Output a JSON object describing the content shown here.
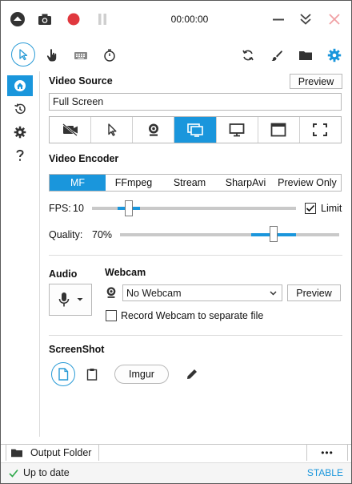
{
  "titlebar": {
    "timer": "00:00:00"
  },
  "video_source": {
    "title": "Video Source",
    "preview_label": "Preview",
    "source_value": "Full Screen",
    "sources": [
      {
        "name": "no-video-icon"
      },
      {
        "name": "region-pointer-icon"
      },
      {
        "name": "webcam-icon"
      },
      {
        "name": "screen-icon",
        "active": true
      },
      {
        "name": "monitor-icon"
      },
      {
        "name": "window-icon"
      },
      {
        "name": "fullscreen-icon"
      }
    ]
  },
  "video_encoder": {
    "title": "Video Encoder",
    "tabs": [
      "MF",
      "FFmpeg",
      "Stream",
      "SharpAvi",
      "Preview Only"
    ],
    "active_tab": "MF",
    "fps_label": "FPS:",
    "fps_value": "10",
    "fps_level": 0.18,
    "limit_label": "Limit",
    "limit_checked": true,
    "quality_label": "Quality:",
    "quality_value": "70%",
    "quality_level": 0.7
  },
  "audio": {
    "title": "Audio"
  },
  "webcam": {
    "title": "Webcam",
    "selected": "No Webcam",
    "preview_label": "Preview",
    "record_separate_label": "Record Webcam to separate file",
    "record_separate_checked": false
  },
  "screenshot": {
    "title": "ScreenShot",
    "imgur_label": "Imgur"
  },
  "output": {
    "folder_label": "Output Folder",
    "more_label": "•••"
  },
  "status": {
    "text": "Up to date",
    "channel": "STABLE"
  },
  "colors": {
    "accent": "#1a96dc",
    "record": "#e0383e"
  }
}
